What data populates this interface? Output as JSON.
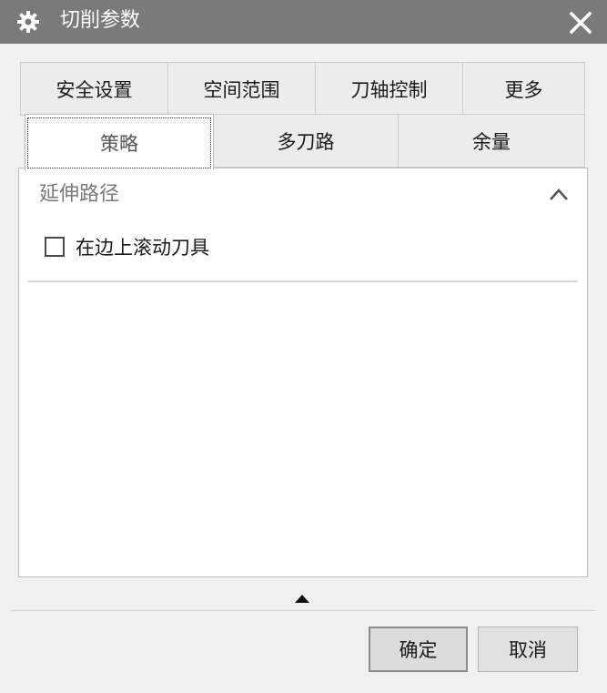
{
  "window": {
    "title": "切削参数",
    "icon": "gear-icon",
    "close_icon": "close-icon"
  },
  "tabs": {
    "top_row": [
      {
        "label": "安全设置"
      },
      {
        "label": "空间范围"
      },
      {
        "label": "刀轴控制"
      },
      {
        "label": "更多"
      }
    ],
    "second_row": [
      {
        "label": "策略",
        "active": true
      },
      {
        "label": "多刀路"
      },
      {
        "label": "余量"
      }
    ]
  },
  "panel": {
    "section": {
      "title": "延伸路径",
      "collapse_icon": "chevron-up-icon",
      "checkbox": {
        "label": "在边上滚动刀具",
        "checked": false
      }
    }
  },
  "footer": {
    "expand_icon": "triangle-up-icon",
    "ok_label": "确定",
    "cancel_label": "取消"
  },
  "colors": {
    "titlebar": "#7a7a7a",
    "background": "#f0f0f0",
    "panel": "#ffffff"
  }
}
